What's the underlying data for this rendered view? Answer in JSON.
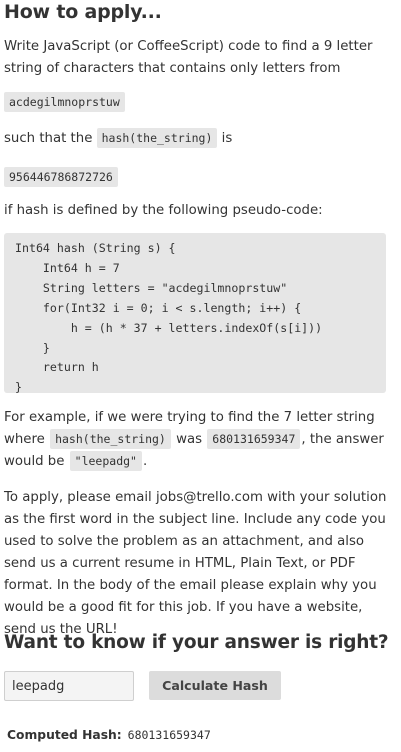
{
  "apply": {
    "heading": "How to apply...",
    "intro": "Write JavaScript (or CoffeeScript) code to find a 9 letter string of characters that contains only letters from",
    "letters": "acdegilmnoprstuw",
    "such_that_prefix": "such that the",
    "hash_call": "hash(the_string)",
    "such_that_suffix": "is",
    "target_hash": "956446786872726",
    "pseudo_intro": "if hash is defined by the following pseudo-code:",
    "pseudo_code": "Int64 hash (String s) {\n    Int64 h = 7\n    String letters = \"acdegilmnoprstuw\"\n    for(Int32 i = 0; i < s.length; i++) {\n        h = (h * 37 + letters.indexOf(s[i]))\n    }\n    return h\n}",
    "example": {
      "text_1": "For example, if we were trying to find the 7 letter string where",
      "hash_call": "hash(the_string)",
      "text_2": "was",
      "hash_value": "680131659347",
      "text_3": ", the answer would be",
      "answer": "\"leepadg\"",
      "text_4": "."
    },
    "instructions": "To apply, please email jobs@trello.com with your solution as the first word in the subject line. Include any code you used to solve the problem as an attachment, and also send us a current resume in HTML, Plain Text, or PDF format. In the body of the email please explain why you would be a good fit for this job. If you have a website, send us the URL!"
  },
  "checker": {
    "heading": "Want to know if your answer is right?",
    "input_value": "leepadg",
    "button_label": "Calculate Hash",
    "computed_label": "Computed Hash:",
    "computed_value": "680131659347"
  }
}
